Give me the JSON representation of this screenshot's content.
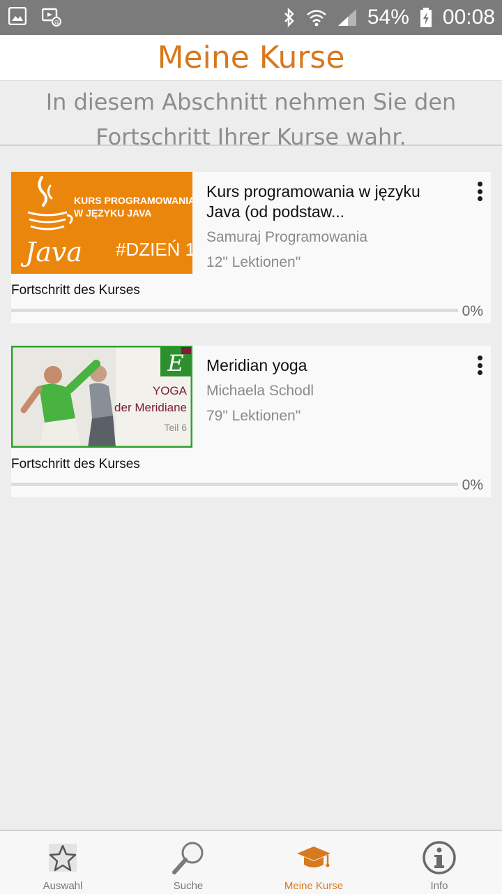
{
  "status_bar": {
    "battery": "54%",
    "time": "00:08",
    "icons": [
      "gallery-icon",
      "screencast-icon",
      "bluetooth-icon",
      "wifi-icon",
      "signal-icon",
      "battery-charging-icon"
    ]
  },
  "header": {
    "title": "Meine Kurse"
  },
  "subtitle": {
    "line1": "In diesem Abschnitt nehmen Sie den",
    "line2": "Fortschritt Ihrer Kurse wahr."
  },
  "courses": [
    {
      "title_line1": "Kurs programowania w języku",
      "title_line2": "Java (od podstaw...",
      "author": "Samuraj Programowania",
      "lessons": "12\" Lektionen\"",
      "progress_label": "Fortschritt des Kurses",
      "progress": 0,
      "progress_text": "0%",
      "thumbnail": {
        "line1": "KURS PROGRAMOWANIA",
        "line2": "W JĘZYKU JAVA",
        "logo_text": "Java",
        "tag": "#DZIEŃ 1",
        "bg_color": "#e8820a"
      }
    },
    {
      "title_line1": "Meridian yoga",
      "author": "Michaela Schodl",
      "lessons": "79\" Lektionen\"",
      "progress_label": "Fortschritt des Kurses",
      "progress": 0,
      "progress_text": "0%",
      "thumbnail": {
        "badge": "E",
        "line1": "YOGA",
        "line2": "der Meridiane",
        "line3": "Teil 6",
        "border_color": "#2ea12e"
      }
    }
  ],
  "bottom_nav": [
    {
      "label": "Auswahl",
      "icon": "star-icon",
      "active": false
    },
    {
      "label": "Suche",
      "icon": "search-icon",
      "active": false
    },
    {
      "label": "Meine Kurse",
      "icon": "graduation-cap-icon",
      "active": true
    },
    {
      "label": "Info",
      "icon": "info-icon",
      "active": false
    }
  ],
  "colors": {
    "accent": "#d7791e",
    "status_bar": "#7b7b7b",
    "background": "#ededed",
    "card": "#f9f9f9"
  }
}
